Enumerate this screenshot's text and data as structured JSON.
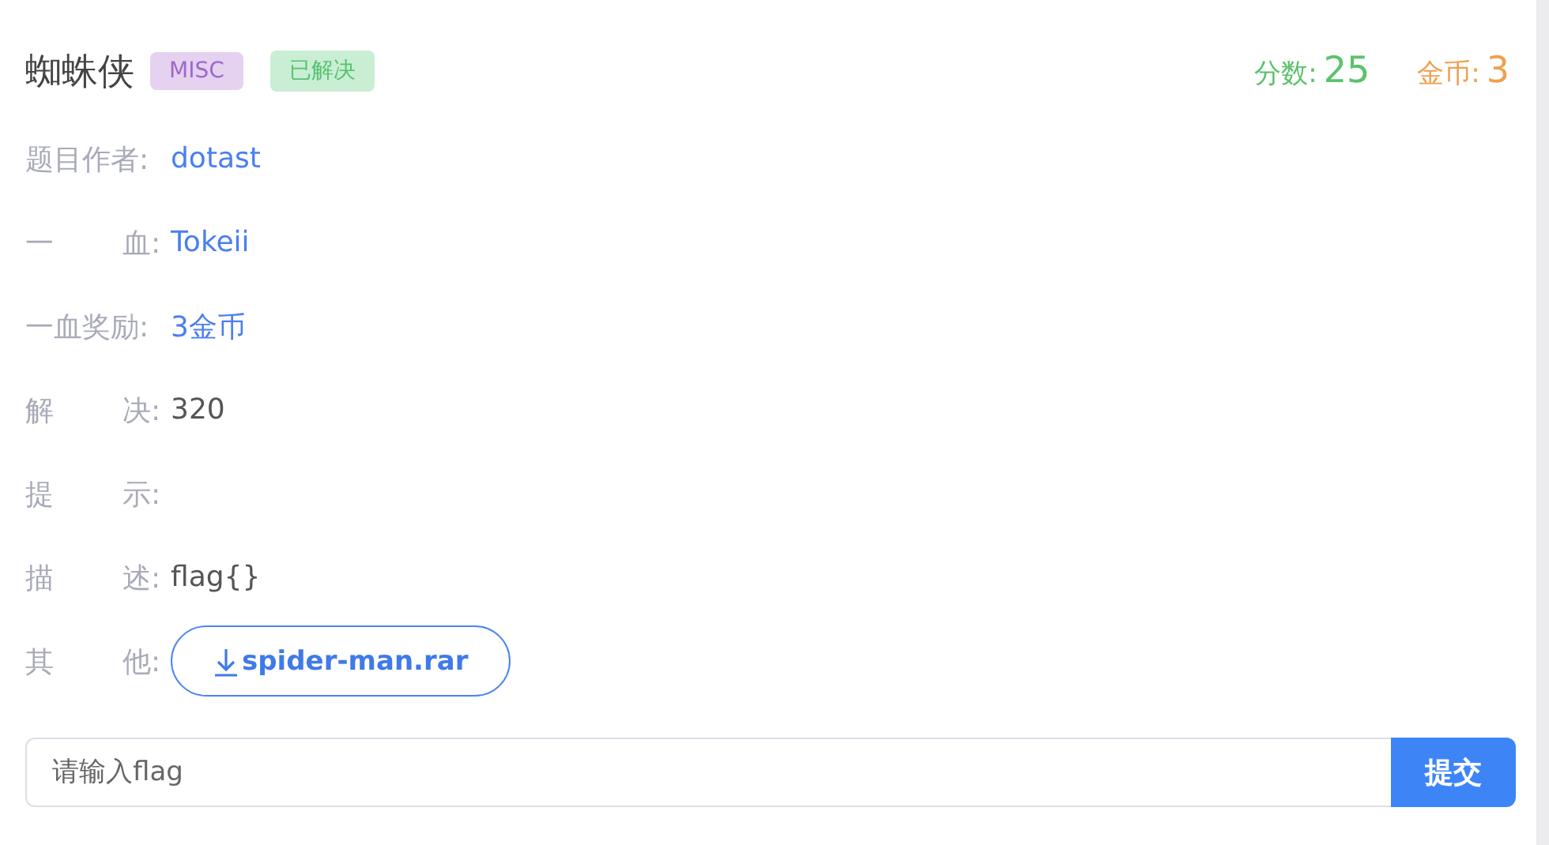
{
  "challenge": {
    "title": "蜘蛛侠",
    "category": "MISC",
    "status": "已解决",
    "solved": true
  },
  "score": {
    "label": "分数:",
    "value": "25"
  },
  "coins": {
    "label": "金币:",
    "value": "3"
  },
  "fields": [
    {
      "label": "题目作者:",
      "kind": "link",
      "value": "dotast"
    },
    {
      "label": "一 血:",
      "kind": "link",
      "value": "Tokeii"
    },
    {
      "label": "一血奖励:",
      "kind": "link",
      "value": "3金币"
    },
    {
      "label": "解 决:",
      "kind": "plain",
      "value": "320"
    },
    {
      "label": "提 示:",
      "kind": "empty"
    },
    {
      "label": "描 述:",
      "kind": "plain",
      "value": "flag{}"
    },
    {
      "label": "其 他:",
      "kind": "download",
      "value": "spider-man.rar"
    }
  ],
  "flag_input": {
    "placeholder": "请输入flag"
  },
  "submit_button": "提交"
}
